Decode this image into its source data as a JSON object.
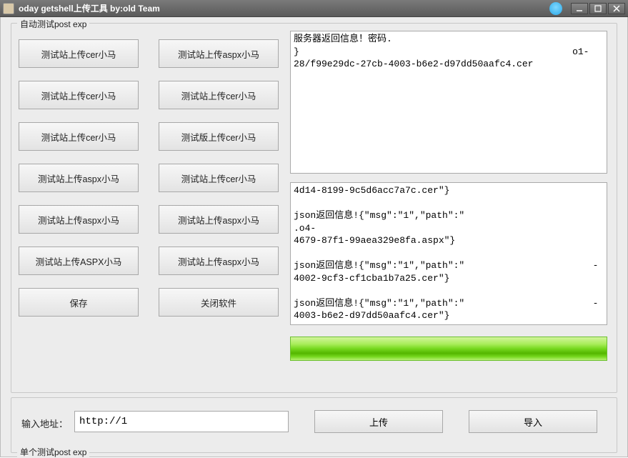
{
  "window": {
    "title": "oday getshell上传工具 by:old Team"
  },
  "group1": {
    "legend": "自动测试post exp",
    "buttons": [
      [
        "测试站上传cer小马",
        "测试站上传aspx小马"
      ],
      [
        "测试站上传cer小马",
        "测试站上传cer小马"
      ],
      [
        "测试站上传cer小马",
        "测试版上传cer小马"
      ],
      [
        "测试站上传aspx小马",
        "测试站上传cer小马"
      ],
      [
        "测试站上传aspx小马",
        "测试站上传aspx小马"
      ],
      [
        "测试站上传ASPX小马",
        "测试站上传aspx小马"
      ],
      [
        "保存",
        "关闭软件"
      ]
    ],
    "output_top": "服务器返回信息！密码.\n}                                                 o1-\n28/f99e29dc-27cb-4003-b6e2-d97dd50aafc4.cer",
    "output_bottom": "4d14-8199-9c5d6acc7a7c.cer\"}\n\njson返回信息!{\"msg\":\"1\",\"path\":\"                      .o4-\n4679-87f1-99aea329e8fa.aspx\"}\n\njson返回信息!{\"msg\":\"1\",\"path\":\"                       -\n4002-9cf3-cf1cba1b7a25.cer\"}\n\njson返回信息!{\"msg\":\"1\",\"path\":\"                       -\n4003-b6e2-d97dd50aafc4.cer\"}"
  },
  "group2": {
    "legend": "单个测试post exp",
    "url_label": "输入地址：",
    "url_value": "http://1",
    "upload_label": "上传",
    "import_label": "导入"
  }
}
